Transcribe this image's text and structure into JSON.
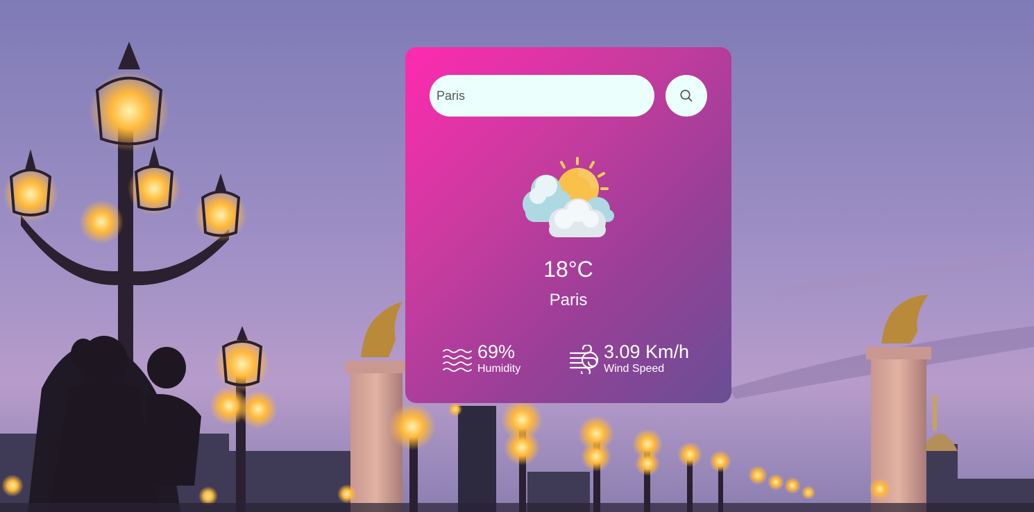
{
  "search": {
    "value": "Paris",
    "placeholder": "",
    "button_icon": "search-icon"
  },
  "weather": {
    "icon": "partly-cloudy-sun-icon",
    "temperature": "18°C",
    "city": "Paris"
  },
  "humidity": {
    "icon": "humidity-waves-icon",
    "value": "69%",
    "label": "Humidity"
  },
  "wind": {
    "icon": "wind-icon",
    "value": "3.09 Km/h",
    "label": "Wind Speed"
  },
  "colors": {
    "card_gradient_start": "#ff2ab0",
    "card_gradient_end": "#684f93",
    "input_background": "#ebfffc",
    "text": "#ffffff"
  }
}
